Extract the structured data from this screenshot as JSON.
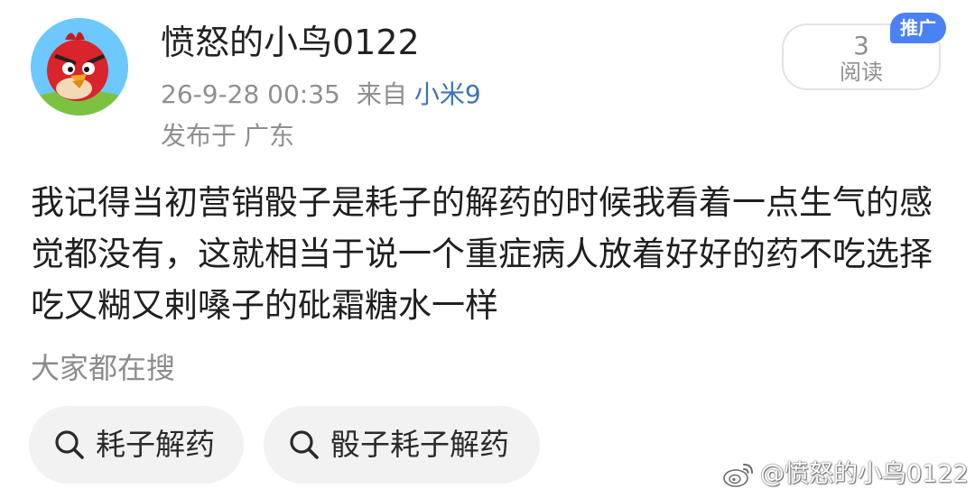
{
  "post": {
    "author": {
      "username": "愤怒的小鸟0122",
      "avatar_icon": "angry-bird-avatar"
    },
    "timestamp": "26-9-28 00:35",
    "from_label": "来自",
    "device": "小米9",
    "location_prefix": "发布于",
    "location": "广东",
    "read_count": "3",
    "read_label": "阅读",
    "promo_badge": "推广",
    "body_text": "我记得当初营销骰子是耗子的解药的时候我看着一点生气的感觉都没有，这就相当于说一个重症病人放着好好的药不吃选择吃又糊又剌嗓子的砒霜糖水一样"
  },
  "hot_search": {
    "title": "大家都在搜",
    "items": [
      {
        "label": "耗子解药",
        "icon": "search-icon"
      },
      {
        "label": "骰子耗子解药",
        "icon": "search-icon"
      }
    ]
  },
  "watermark": {
    "logo_icon": "weibo-logo-icon",
    "text": "@愤怒的小鸟0122"
  },
  "colors": {
    "link_blue": "#3f74b3",
    "badge_blue": "#4a82f5",
    "meta_gray": "#8f8f8f",
    "chip_bg": "#f2f2f2"
  }
}
